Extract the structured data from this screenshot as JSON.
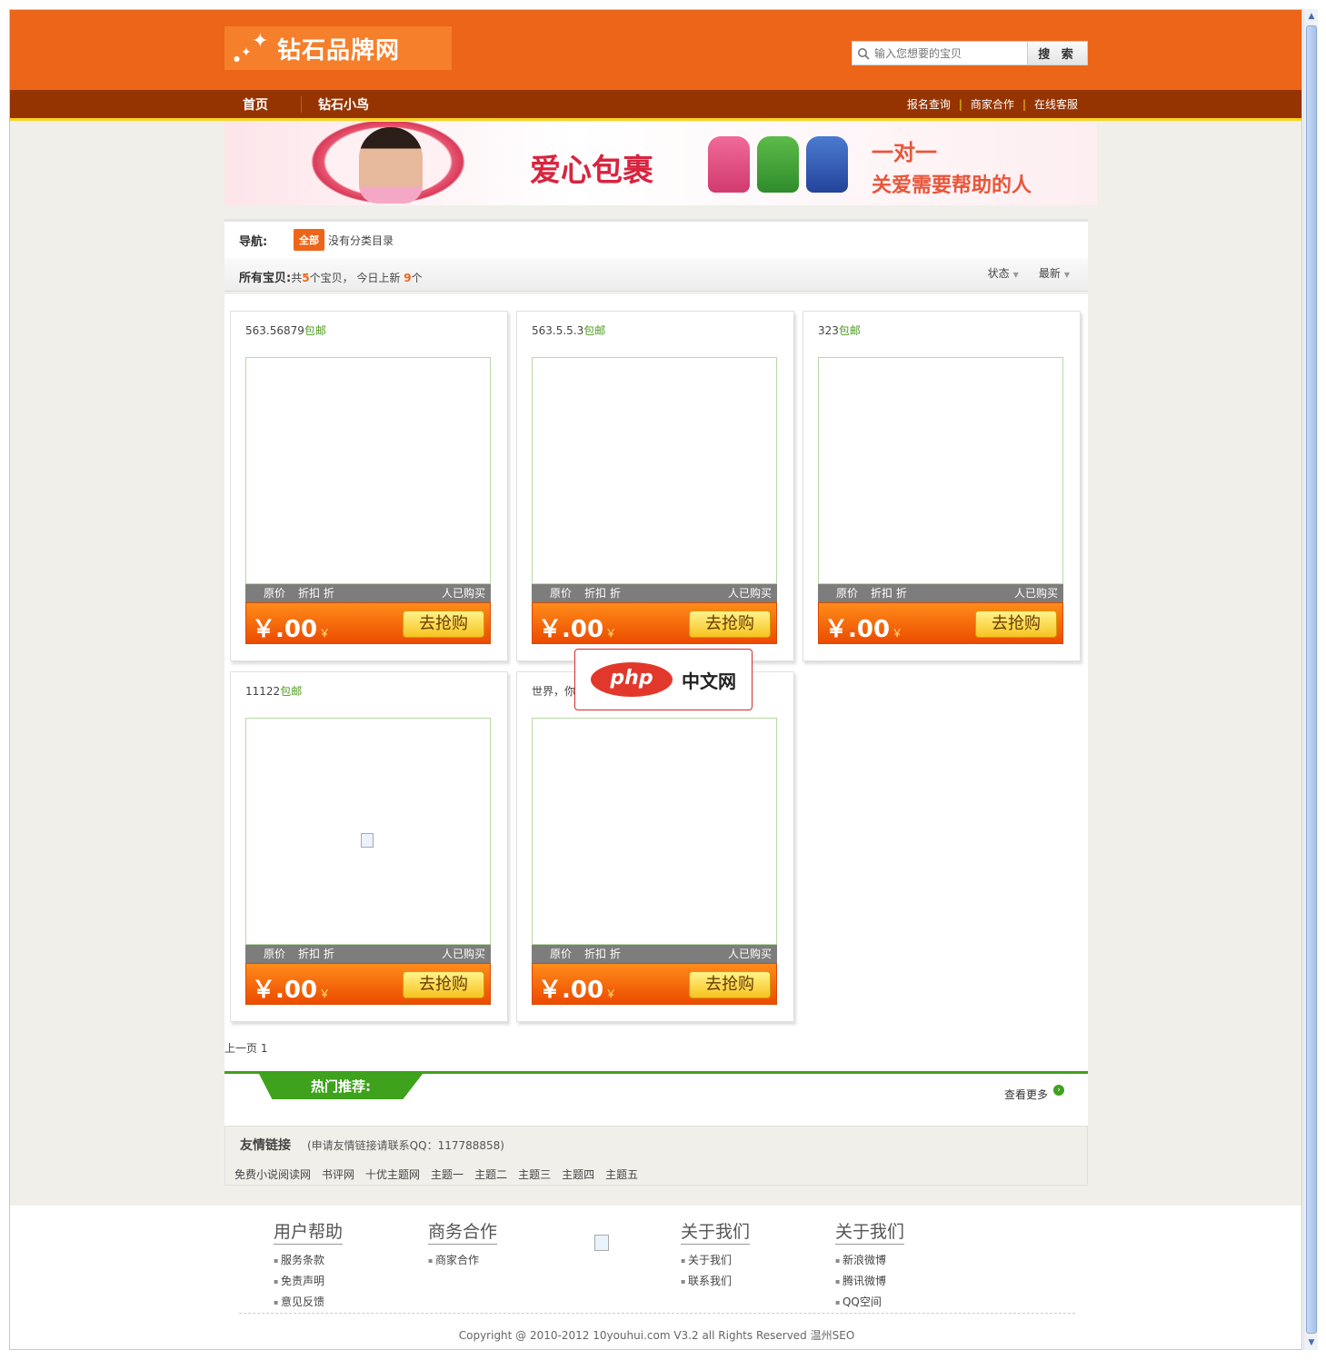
{
  "header": {
    "logo_text": "钻石品牌网",
    "search_placeholder": "输入您想要的宝贝",
    "search_button": "搜 索"
  },
  "nav": {
    "left": [
      "首页",
      "钻石小鸟"
    ],
    "right": [
      "报名查询",
      "商家合作",
      "在线客服"
    ],
    "separator": "|"
  },
  "banner": {
    "title": "爱心包裹",
    "line1": "一对一",
    "line2": "关爱需要帮助的人"
  },
  "filter": {
    "label": "导航:",
    "tag_all": "全部",
    "tag_none": "没有分类目录",
    "count_label": "所有宝贝:",
    "count_prefix": "共",
    "total": "5",
    "count_mid": "个宝贝，  今日上新 ",
    "today": "9",
    "count_suffix": "个",
    "sorts": [
      "状态",
      "最新"
    ]
  },
  "products": [
    {
      "title": "563.56879",
      "ship": "包邮",
      "orig": "原价",
      "disc": "折扣 折",
      "sold": "人已购买",
      "price": "￥.00",
      "price_unit": "￥",
      "buy": "去抢购",
      "broken_img": false
    },
    {
      "title": "563.5.5.3",
      "ship": "包邮",
      "orig": "原价",
      "disc": "折扣 折",
      "sold": "人已购买",
      "price": "￥.00",
      "price_unit": "￥",
      "buy": "去抢购",
      "broken_img": false
    },
    {
      "title": "323",
      "ship": "包邮",
      "orig": "原价",
      "disc": "折扣 折",
      "sold": "人已购买",
      "price": "￥.00",
      "price_unit": "￥",
      "buy": "去抢购",
      "broken_img": false
    },
    {
      "title": "11122",
      "ship": "包邮",
      "orig": "原价",
      "disc": "折扣 折",
      "sold": "人已购买",
      "price": "￥.00",
      "price_unit": "￥",
      "buy": "去抢购",
      "broken_img": true
    },
    {
      "title": "世界，你",
      "ship": "",
      "orig": "原价",
      "disc": "折扣 折",
      "sold": "人已购买",
      "price": "￥.00",
      "price_unit": "￥",
      "buy": "去抢购",
      "broken_img": false
    }
  ],
  "php_badge": {
    "logo": "php",
    "text": "中文网"
  },
  "pager": "上一页 1",
  "hot": {
    "title": "热门推荐:",
    "more": "查看更多"
  },
  "friends": {
    "title": "友情链接",
    "note": "(申请友情链接请联系QQ：117788858)",
    "links": [
      "免费小说阅读网",
      "书评网",
      "十优主题网",
      "主题一",
      "主题二",
      "主题三",
      "主题四",
      "主题五"
    ]
  },
  "footer": {
    "columns": [
      {
        "title": "用户帮助",
        "items": [
          "服务条款",
          "免责声明",
          "意见反馈"
        ]
      },
      {
        "title": "商务合作",
        "items": [
          "商家合作"
        ]
      },
      {
        "title": "关于我们",
        "items": [
          "关于我们",
          "联系我们"
        ]
      },
      {
        "title": "关于我们",
        "items": [
          "新浪微博",
          "腾讯微博",
          "QQ空间"
        ]
      }
    ],
    "copyright": "Copyright @ 2010-2012 10youhui.com V3.2 all Rights Reserved 温州SEO"
  },
  "colors": {
    "brand_orange": "#ec6519",
    "nav_brown": "#963401",
    "accent_yellow": "#f8d320",
    "green": "#3ea21c"
  }
}
